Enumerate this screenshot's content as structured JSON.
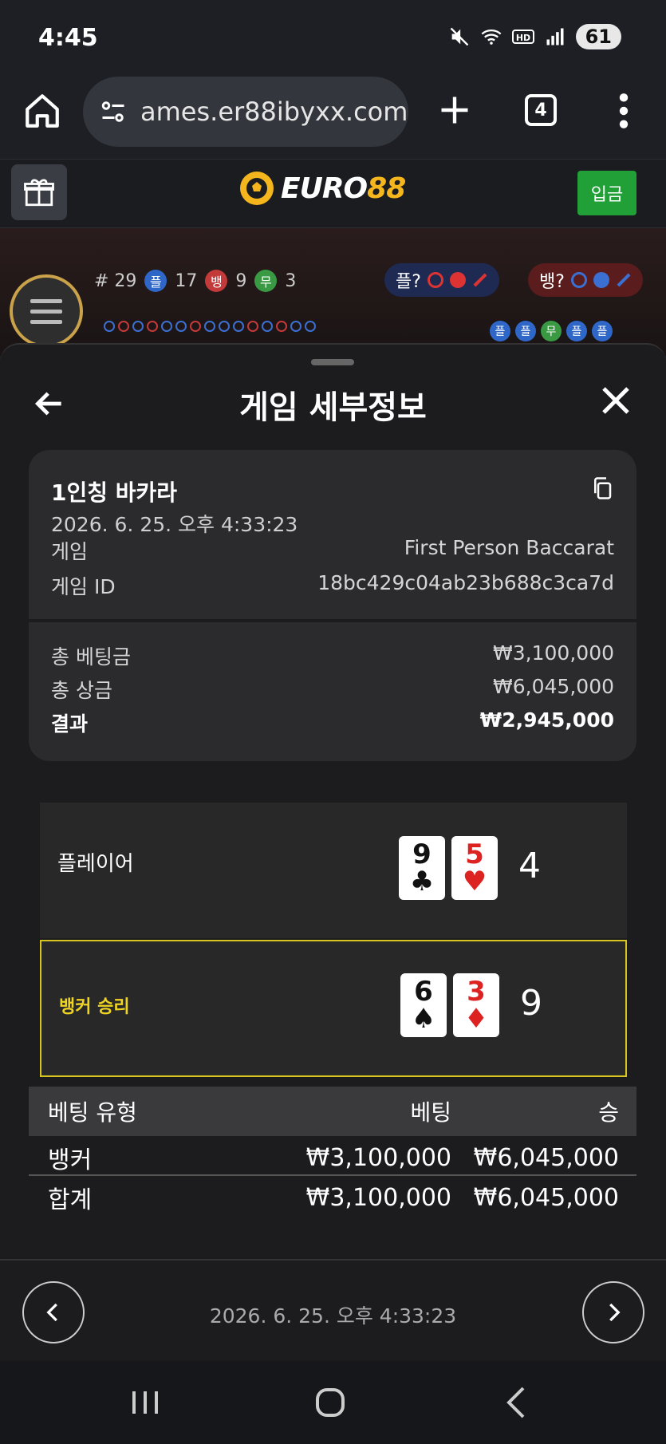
{
  "status_bar": {
    "time": "4:45",
    "battery": "61"
  },
  "browser": {
    "url": "ames.er88ibyxx.com",
    "tab_count": "4"
  },
  "site": {
    "logo_main": "EURO",
    "logo_accent": "88",
    "deposit_label": "입금"
  },
  "game_strip": {
    "round": "# 29",
    "player_badge": "플",
    "player_count": "17",
    "banker_badge": "뱅",
    "banker_count": "9",
    "tie_badge": "무",
    "tie_count": "3",
    "player_predict": "플?",
    "banker_predict": "뱅?",
    "road_right": [
      "플",
      "플",
      "무",
      "플",
      "플"
    ]
  },
  "sheet": {
    "title": "게임 세부정보",
    "game_name": "1인칭 바카라",
    "game_datetime": "2026. 6. 25. 오후 4:33:23",
    "game_label": "게임",
    "game_value": "First Person Baccarat",
    "game_id_label": "게임 ID",
    "game_id_value": "18bc429c04ab23b688c3ca7d",
    "total_bet_label": "총 베팅금",
    "total_bet_value": "₩3,100,000",
    "total_win_label": "총 상금",
    "total_win_value": "₩6,045,000",
    "result_label": "결과",
    "result_value": "₩2,945,000"
  },
  "hands": {
    "player_label": "플레이어",
    "player_cards": [
      {
        "rank": "9",
        "suit": "♣",
        "color": "black"
      },
      {
        "rank": "5",
        "suit": "♥",
        "color": "red"
      }
    ],
    "player_total": "4",
    "banker_label": "뱅커 승리",
    "banker_cards": [
      {
        "rank": "6",
        "suit": "♠",
        "color": "black"
      },
      {
        "rank": "3",
        "suit": "♦",
        "color": "red"
      }
    ],
    "banker_total": "9",
    "winner_color": "#d8c41e"
  },
  "bet_table": {
    "headers": [
      "베팅 유형",
      "베팅",
      "승"
    ],
    "rows": [
      [
        "뱅커",
        "₩3,100,000",
        "₩6,045,000"
      ],
      [
        "합계",
        "₩3,100,000",
        "₩6,045,000"
      ]
    ]
  },
  "footer": {
    "datetime": "2026. 6. 25. 오후 4:33:23"
  }
}
